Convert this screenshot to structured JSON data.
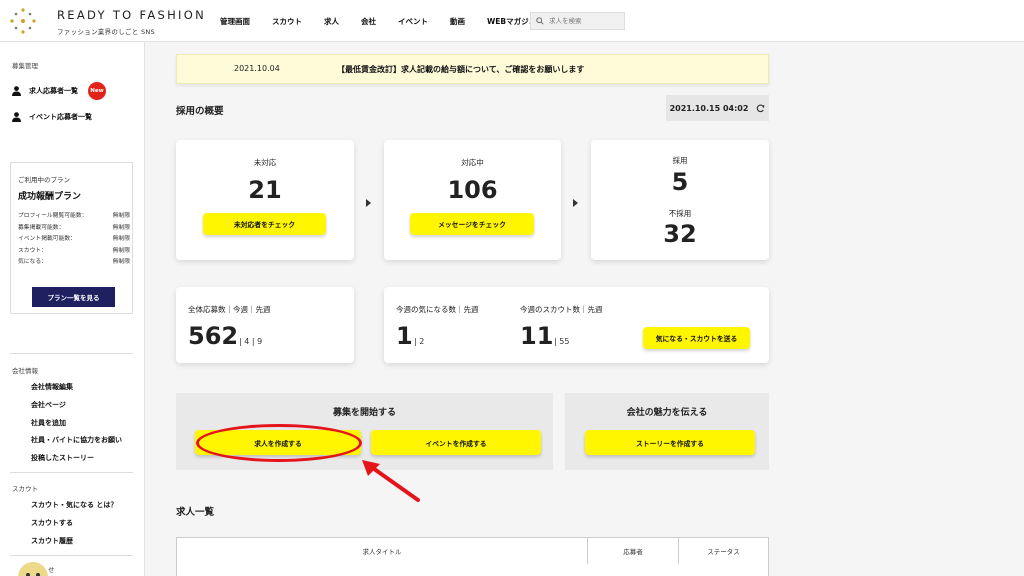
{
  "header": {
    "brand_title": "READY TO FASHION",
    "brand_sub": "ファッション業界のしごと SNS",
    "nav": [
      "管理画面",
      "スカウト",
      "求人",
      "会社",
      "イベント",
      "動画",
      "WEBマガジン"
    ],
    "search_placeholder": "求人を検索"
  },
  "sidebar": {
    "recruit_label": "募集管理",
    "links": [
      {
        "label": "求人応募者一覧",
        "badge": "New"
      },
      {
        "label": "イベント応募者一覧"
      }
    ],
    "plan": {
      "label": "ご利用中のプラン",
      "name": "成功報酬プラン",
      "rows": [
        {
          "key": "プロフィール閲覧可能数：",
          "value": "無制限"
        },
        {
          "key": "募集掲載可能数：",
          "value": "無制限"
        },
        {
          "key": "イベント掲載可能数：",
          "value": "無制限"
        },
        {
          "key": "スカウト：",
          "value": "無制限"
        },
        {
          "key": "気になる：",
          "value": "無制限"
        }
      ],
      "button": "プラン一覧を見る"
    },
    "company_label": "会社情報",
    "company_links": [
      "会社情報編集",
      "会社ページ",
      "社員を追加",
      "社員・バイトに協力をお願い",
      "投稿したストーリー"
    ],
    "scout_label": "スカウト",
    "scout_links": [
      "スカウト・気になる とは？",
      "スカウトする",
      "スカウト履歴"
    ],
    "cut_label": "せ"
  },
  "notice": {
    "date": "2021.10.04",
    "text": "【最低賃金改訂】求人記載の給与額について、ご確認をお願いします"
  },
  "overview": {
    "title": "採用の概要",
    "timestamp": "2021.10.15 04:02",
    "pending": {
      "label": "未対応",
      "value": "21",
      "button": "未対応者をチェック"
    },
    "in_progress": {
      "label": "対応中",
      "value": "106",
      "button": "メッセージをチェック"
    },
    "hired": {
      "label": "採用",
      "value": "5"
    },
    "rejected": {
      "label": "不採用",
      "value": "32"
    }
  },
  "stats": {
    "applications_label": "全体応募数｜今週｜先週",
    "applications_total": "562",
    "applications_week": "4",
    "applications_last": "9",
    "interest_label": "今週の気になる数｜先週",
    "interest_week": "1",
    "interest_last": "2",
    "scout_label": "今週のスカウト数｜先週",
    "scout_week": "11",
    "scout_last": "55",
    "send_button": "気になる・スカウトを送る"
  },
  "start_panel": {
    "title": "募集を開始する",
    "job_button": "求人を作成する",
    "event_button": "イベントを作成する"
  },
  "story_panel": {
    "title": "会社の魅力を伝える",
    "button": "ストーリーを作成する"
  },
  "jobs": {
    "title": "求人一覧",
    "columns": [
      "求人タイトル",
      "応募者",
      "ステータス"
    ]
  },
  "colors": {
    "accent_yellow": "#fff600",
    "navy": "#1e2060",
    "badge_red": "#e2231a",
    "annotation_red": "#e4141a"
  }
}
